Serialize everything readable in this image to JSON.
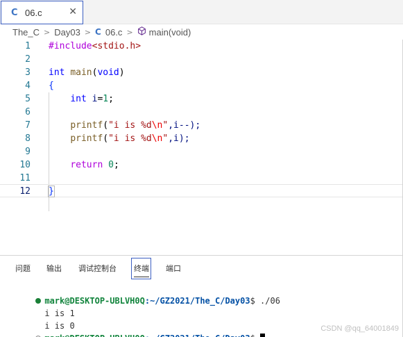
{
  "tab": {
    "icon": "c-language-icon",
    "icon_glyph": "C",
    "label": "06.c",
    "close": "✕"
  },
  "breadcrumb": {
    "items": [
      "The_C",
      "Day03",
      "06.c",
      "main(void)"
    ],
    "file_icon_glyph": "C"
  },
  "editor": {
    "lines": [
      {
        "n": "1"
      },
      {
        "n": "2"
      },
      {
        "n": "3"
      },
      {
        "n": "4"
      },
      {
        "n": "5"
      },
      {
        "n": "6"
      },
      {
        "n": "7"
      },
      {
        "n": "8"
      },
      {
        "n": "9"
      },
      {
        "n": "10"
      },
      {
        "n": "11"
      },
      {
        "n": "12"
      }
    ],
    "code": {
      "l1_include": "#include",
      "l1_header": "<stdio.h>",
      "l3_int": "int",
      "l3_main": "main",
      "l3_paren_open": "(",
      "l3_void": "void",
      "l3_paren_close": ")",
      "l4_brace": "{",
      "l5_int": "int",
      "l5_rest_var": "i",
      "l5_eq": "=",
      "l5_num": "1",
      "l5_semi": ";",
      "l7_printf": "printf",
      "l7_open": "(",
      "l7_str1": "\"i is %d",
      "l7_esc": "\\n",
      "l7_str2": "\"",
      "l7_rest": ",i--);",
      "l8_printf": "printf",
      "l8_open": "(",
      "l8_str1": "\"i is %d",
      "l8_esc": "\\n",
      "l8_str2": "\"",
      "l8_rest": ",i);",
      "l10_return": "return",
      "l10_num": "0",
      "l10_semi": ";",
      "l12_brace": "}"
    },
    "current_line": "12"
  },
  "panel": {
    "tabs": [
      "问题",
      "输出",
      "调试控制台",
      "终端",
      "端口"
    ],
    "active_tab": "终端"
  },
  "terminal": {
    "prompt_user": "mark@DESKTOP-UBLVH0Q",
    "prompt_path": ":~/GZ2021/The_C/Day03",
    "prompt_symbol": "$",
    "command": " ./06",
    "output": [
      "i is 1",
      "i is 0"
    ]
  },
  "watermark": "CSDN @qq_64001849",
  "colors": {
    "accent": "#3b5ec1",
    "c_icon": "#3e75c4",
    "terminal_user": "#11843c",
    "terminal_path": "#0451a5",
    "status_dot": "#1a7f37"
  }
}
